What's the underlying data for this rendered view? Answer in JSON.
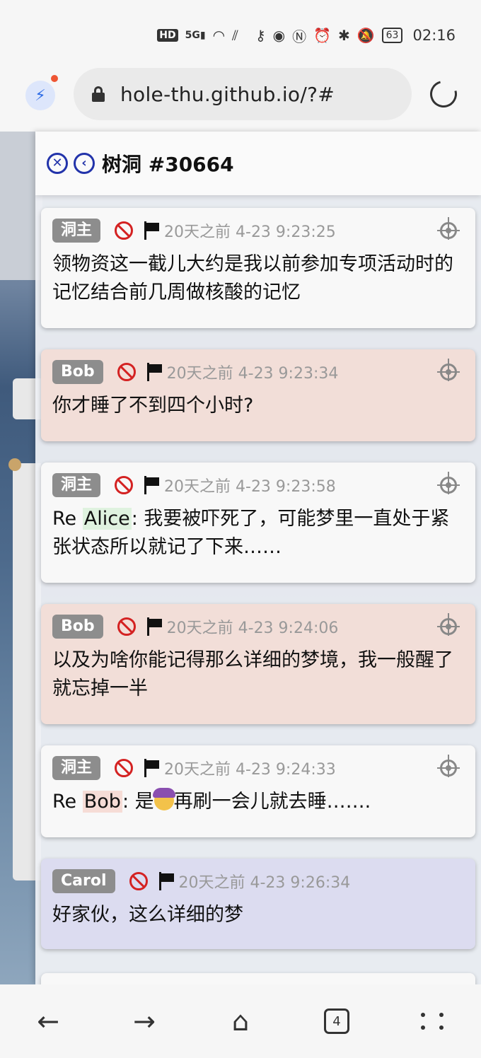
{
  "status_bar": {
    "network_badge": "HD",
    "network_type": "5G",
    "battery": "63",
    "time": "02:16"
  },
  "browser": {
    "url": "hole-thu.github.io/?#",
    "tab_count": "4"
  },
  "panel": {
    "title": "树洞 #30664"
  },
  "replies": [
    {
      "name": "洞主",
      "time": "20天之前 4-23 9:23:25",
      "text": "领物资这一截儿大约是我以前参加专项活动时的记忆结合前几周做核酸的记忆",
      "color": "#f8f8f8"
    },
    {
      "name": "Bob",
      "time": "20天之前 4-23 9:23:34",
      "text": "你才睡了不到四个小时?",
      "color": "#f2ded8"
    },
    {
      "name": "洞主",
      "time": "20天之前 4-23 9:23:58",
      "prefix": "Re ",
      "mention": "Alice",
      "text": ": 我要被吓死了，可能梦里一直处于紧张状态所以就记了下来……",
      "color": "#f8f8f8"
    },
    {
      "name": "Bob",
      "time": "20天之前 4-23 9:24:06",
      "text": "以及为啥你能记得那么详细的梦境，我一般醒了就忘掉一半",
      "color": "#f2ded8"
    },
    {
      "name": "洞主",
      "time": "20天之前 4-23 9:24:33",
      "prefix": "Re ",
      "mention": "Bob",
      "text_a": ": 是",
      "text_b": "再刷一会儿就去睡…….",
      "emoji": "woman-facepalming",
      "color": "#f8f8f8"
    },
    {
      "name": "Carol",
      "time": "20天之前 4-23 9:26:34",
      "text": "好家伙，这么详细的梦",
      "color": "#dcdcf0"
    }
  ]
}
